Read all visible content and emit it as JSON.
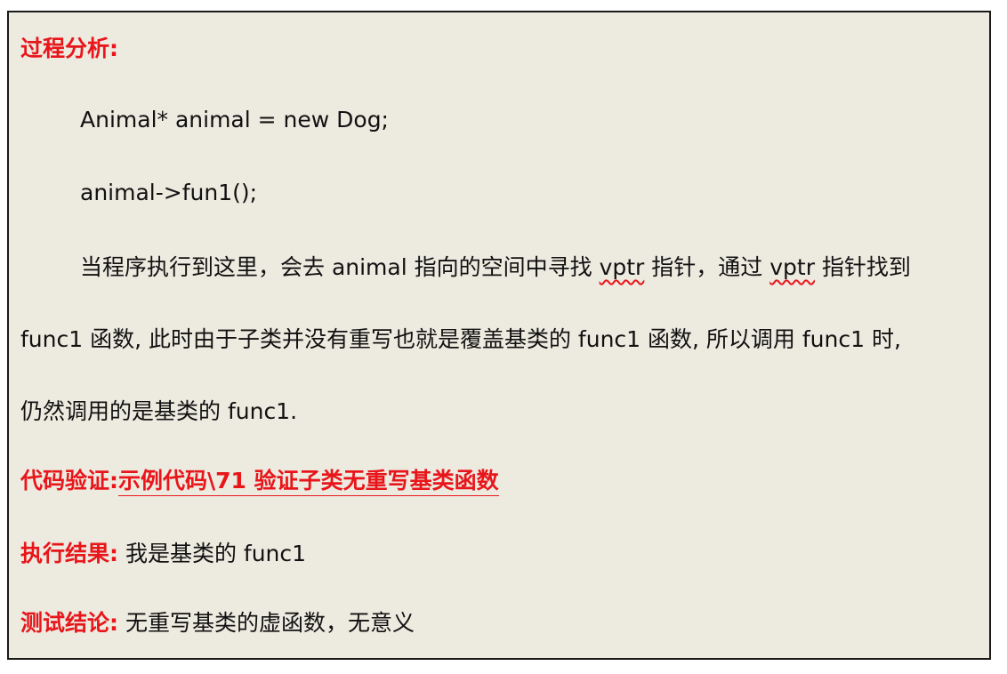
{
  "analysis": {
    "heading": "过程分析:",
    "code_line1": "Animal* animal = new Dog;",
    "code_line2": "animal->fun1();",
    "para1_a": "当程序执行到这里，会去 animal 指向的空间中寻找 ",
    "para1_vptr1": "vptr",
    "para1_b": " 指针，通过 ",
    "para1_vptr2": "vptr",
    "para1_c": " 指针找到",
    "para2": "func1 函数, 此时由于子类并没有重写也就是覆盖基类的 func1 函数, 所以调用 func1 时,",
    "para3": "仍然调用的是基类的 func1."
  },
  "verification": {
    "label": "代码验证:",
    "link": "示例代码\\71  验证子类无重写基类函数"
  },
  "result": {
    "label": "执行结果:",
    "value": " 我是基类的 func1"
  },
  "conclusion": {
    "label": "测试结论:",
    "value": " 无重写基类的虚函数，无意义"
  }
}
